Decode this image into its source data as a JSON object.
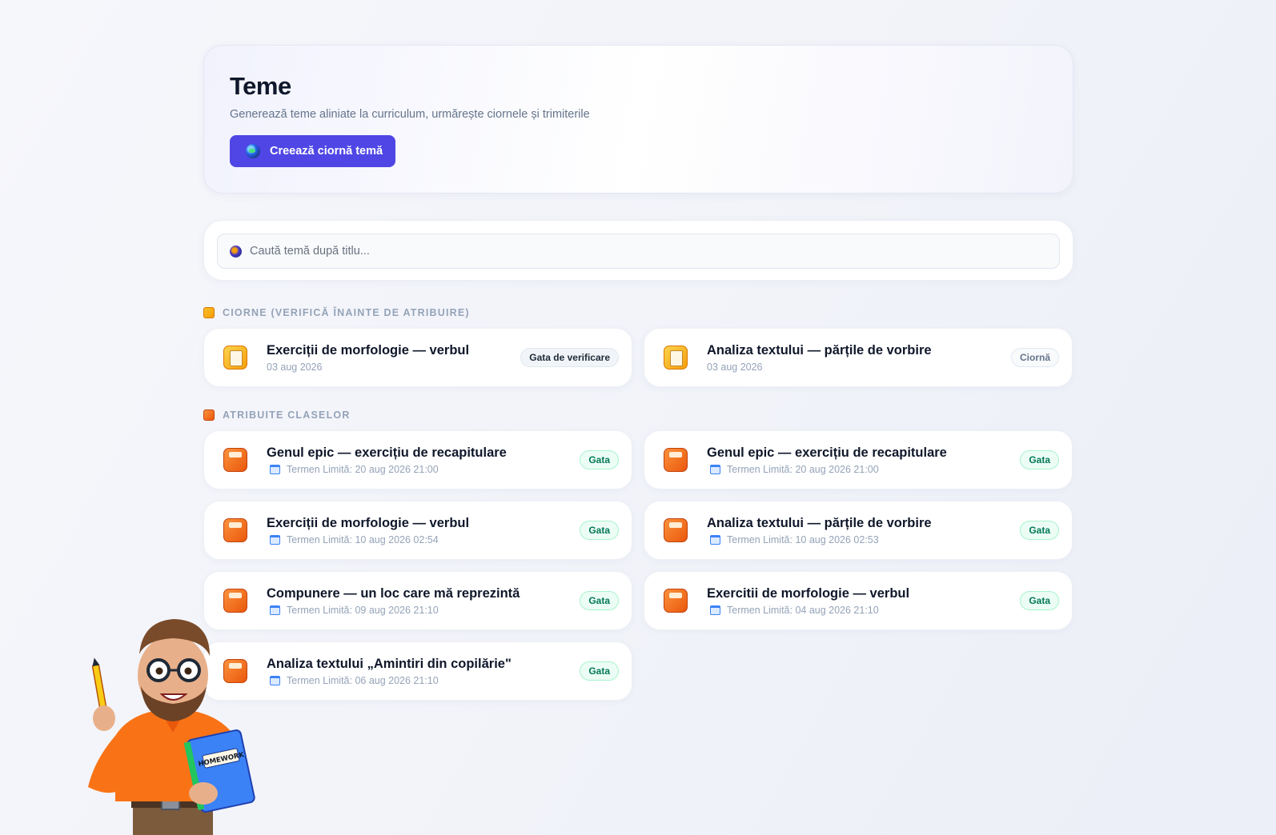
{
  "header": {
    "title": "Teme",
    "subtitle": "Generează teme aliniate la curriculum, urmărește ciornele și trimiterile",
    "create_label": "Creează ciornă temă"
  },
  "search": {
    "placeholder": "Caută temă după titlu..."
  },
  "drafts": {
    "heading": "Ciorne (verifică înainte de atribuire)",
    "items": [
      {
        "title": "Exerciții de morfologie — verbul",
        "date": "03 aug 2026",
        "status": "Gata de verificare"
      },
      {
        "title": "Analiza textului — părțile de vorbire",
        "date": "03 aug 2026",
        "status": "Ciornă"
      }
    ]
  },
  "assigned": {
    "heading": "Atribuite claselor",
    "items": [
      {
        "title": "Genul epic — exercițiu de recapitulare",
        "due": "Termen Limită: 20 aug 2026 21:00",
        "status": "Gata"
      },
      {
        "title": "Genul epic — exercițiu de recapitulare",
        "due": "Termen Limită: 20 aug 2026 21:00",
        "status": "Gata"
      },
      {
        "title": "Exerciții de morfologie — verbul",
        "due": "Termen Limită: 10 aug 2026 02:54",
        "status": "Gata"
      },
      {
        "title": "Analiza textului — părțile de vorbire",
        "due": "Termen Limită: 10 aug 2026 02:53",
        "status": "Gata"
      },
      {
        "title": "Compunere — un loc care mă reprezintă",
        "due": "Termen Limită: 09 aug 2026 21:10",
        "status": "Gata"
      },
      {
        "title": "Exercitii de morfologie — verbul",
        "due": "Termen Limită: 04 aug 2026 21:10",
        "status": "Gata"
      },
      {
        "title": "Analiza textului „Amintiri din copilărie\"",
        "due": "Termen Limită: 06 aug 2026 21:10",
        "status": "Gata"
      }
    ]
  },
  "mascot": {
    "book_label": "HOMEWORK"
  },
  "colors": {
    "accent": "#4f46e5",
    "done_badge": "#047857",
    "draft_icon": "#f59e0b",
    "assigned_icon": "#ea580c"
  }
}
